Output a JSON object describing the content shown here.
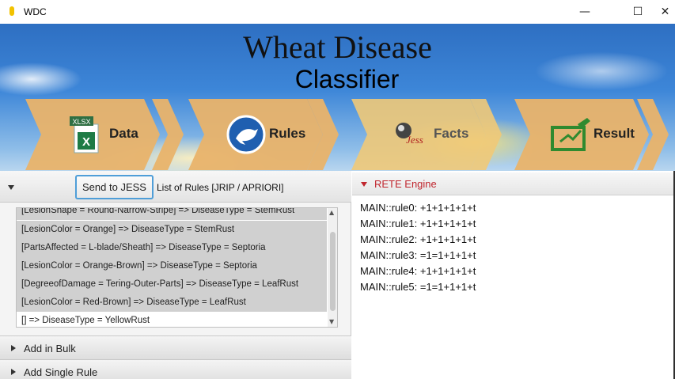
{
  "window": {
    "title": "WDC",
    "minimize": "—",
    "maximize": "☐",
    "close": "✕"
  },
  "banner": {
    "title": "Wheat Disease",
    "subtitle": "Classifier",
    "steps": [
      {
        "label": "Data",
        "icon": "excel-xlsx-icon",
        "icon_text": "XLSX"
      },
      {
        "label": "Rules",
        "icon": "crow-icon"
      },
      {
        "label": "Facts",
        "icon": "jess-icon",
        "icon_text": "Jess"
      },
      {
        "label": "Result",
        "icon": "chart-pen-icon"
      }
    ]
  },
  "left_panel": {
    "send_button": "Send to JESS",
    "rules_caption": "List of Rules [JRIP / APRIORI]",
    "rules": [
      "[LesionShape = Round-Narrow-Stripe] => DiseaseType = StemRust",
      "[LesionColor = Orange] => DiseaseType = StemRust",
      "[PartsAffected = L-blade/Sheath] => DiseaseType = Septoria",
      "[LesionColor = Orange-Brown] => DiseaseType = Septoria",
      "[DegreeofDamage = Tering-Outer-Parts] => DiseaseType = LeafRust",
      "[LesionColor = Red-Brown] => DiseaseType = LeafRust",
      "[] => DiseaseType = YellowRust"
    ],
    "sections": [
      "Add in Bulk",
      "Add Single Rule"
    ]
  },
  "right_panel": {
    "title": "RETE Engine",
    "lines": [
      "MAIN::rule0: +1+1+1+1+t",
      "MAIN::rule1: +1+1+1+1+t",
      "MAIN::rule2: +1+1+1+1+t",
      "MAIN::rule3: =1=1+1+1+t",
      "MAIN::rule4: +1+1+1+1+t",
      "MAIN::rule5: =1=1+1+1+t"
    ]
  },
  "colors": {
    "chevron": "#e9b36a",
    "rete_title": "#c0262e",
    "button_focus": "#4f9ed8"
  }
}
